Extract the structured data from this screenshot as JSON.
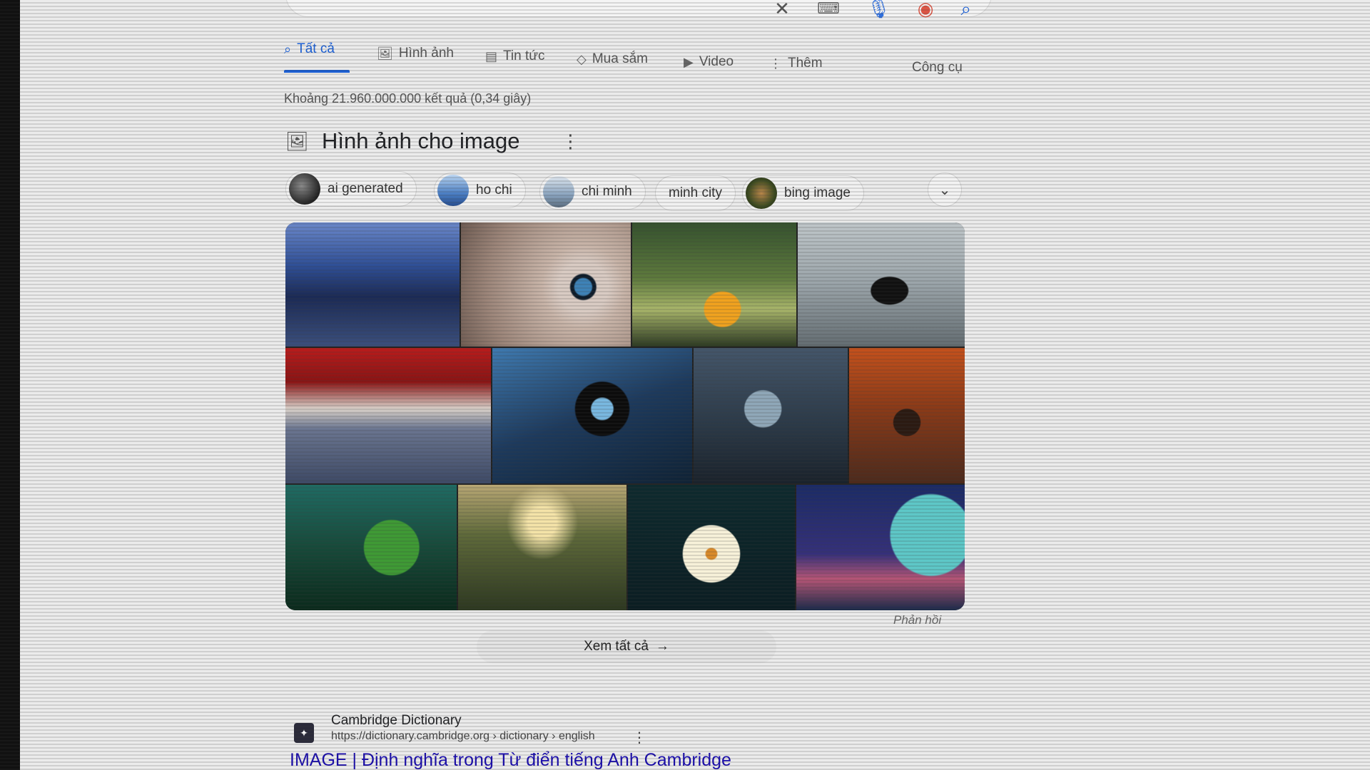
{
  "search_bar": {
    "icons": [
      "close-icon",
      "keyboard-icon",
      "mic-icon",
      "lens-icon",
      "search-icon"
    ]
  },
  "tabs": [
    {
      "label": "Tất cả",
      "icon": "search-icon",
      "active": true
    },
    {
      "label": "Hình ảnh",
      "icon": "image-icon"
    },
    {
      "label": "Tin tức",
      "icon": "news-icon"
    },
    {
      "label": "Mua sắm",
      "icon": "tag-icon"
    },
    {
      "label": "Video",
      "icon": "play-icon"
    },
    {
      "label": "Thêm",
      "icon": "more-vert-icon"
    }
  ],
  "tools_label": "Công cụ",
  "result_stats": "Khoảng 21.960.000.000 kết quả (0,34 giây)",
  "images_section": {
    "title": "Hình ảnh cho image",
    "chips": [
      {
        "label": "ai generated"
      },
      {
        "label": "ho chi"
      },
      {
        "label": "chi minh"
      },
      {
        "label": "minh city"
      },
      {
        "label": "bing image"
      }
    ],
    "tiles": [
      "bridge-road-photo",
      "eye-closeup-photo",
      "woman-camera-photo",
      "camera-on-table-photo",
      "red-tree-lake-photo",
      "lens-in-hand-photo",
      "boy-and-robot-photo",
      "autumn-lens-photo",
      "green-planet-photo",
      "sunset-grass-photo",
      "white-flower-photo",
      "space-planet-photo"
    ],
    "feedback": "Phản hồi",
    "see_all": "Xem tất cả"
  },
  "result": {
    "site_name": "Cambridge Dictionary",
    "url": "https://dictionary.cambridge.org › dictionary › english",
    "title": "IMAGE | Định nghĩa trong Từ điển tiếng Anh Cambridge"
  },
  "colors": {
    "accent": "#1a5fd6",
    "link": "#1a0dab",
    "background": "#ebebeb"
  }
}
